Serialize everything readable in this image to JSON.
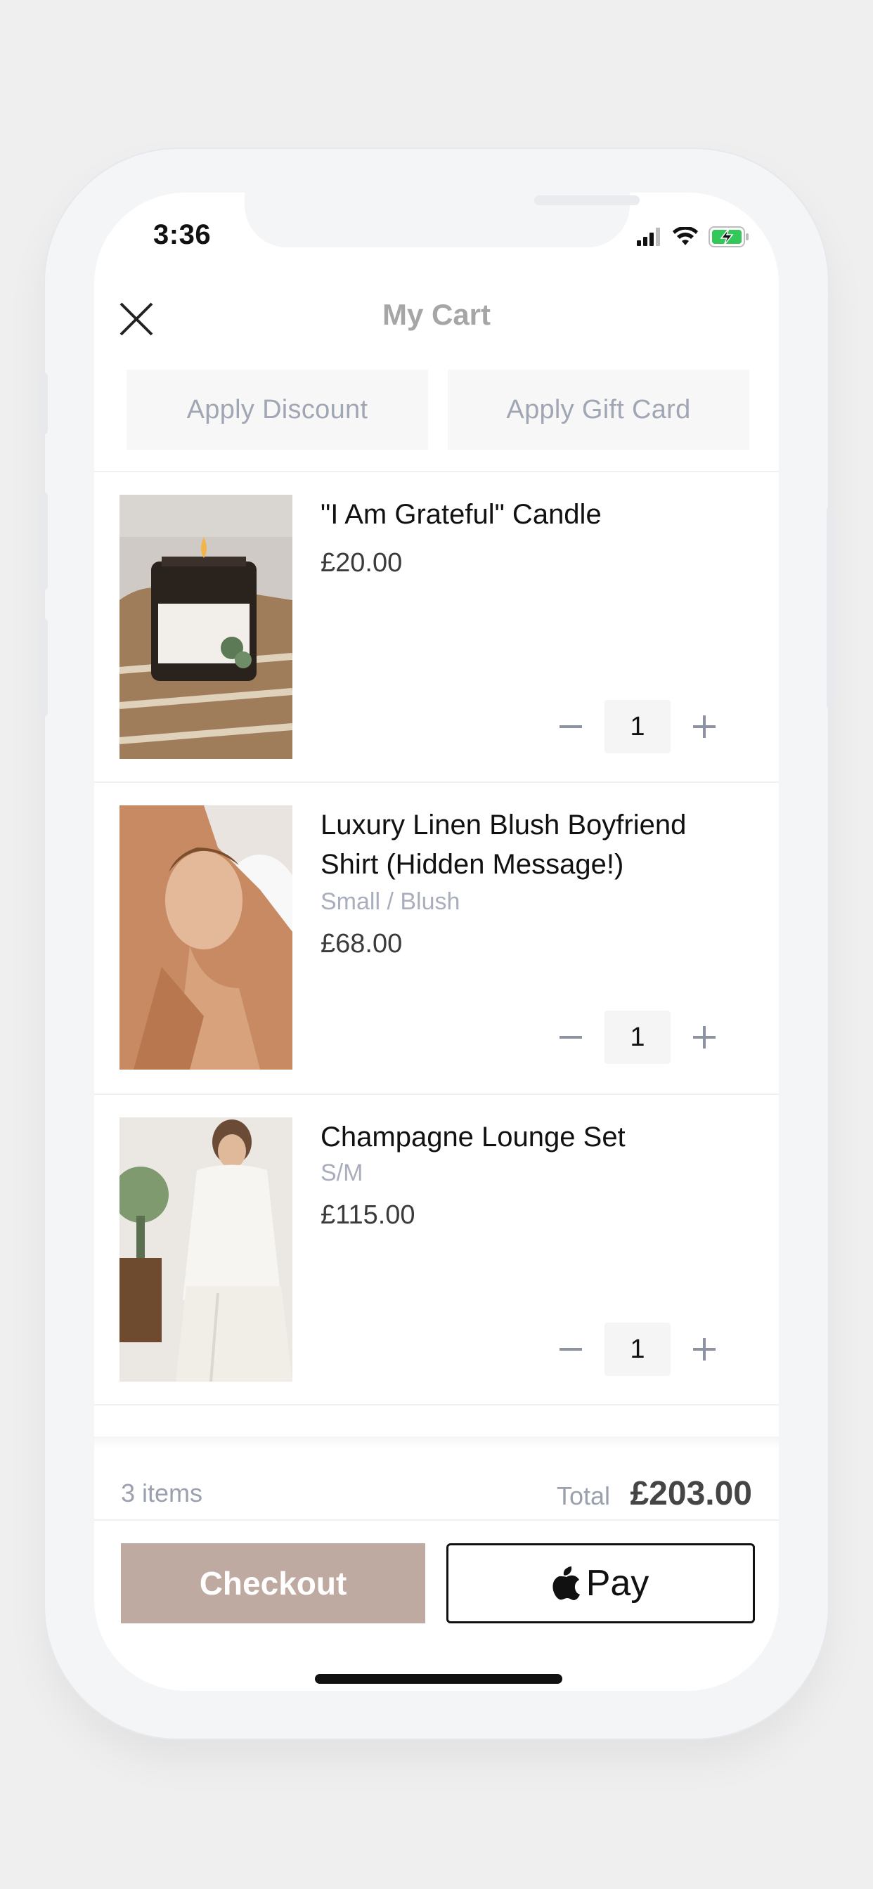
{
  "status_bar": {
    "time": "3:36",
    "icons": [
      "cellular-icon",
      "wifi-icon",
      "battery-charging-icon"
    ]
  },
  "header": {
    "title": "My Cart",
    "close_icon": "close-icon"
  },
  "tabs": [
    {
      "label": "Apply Discount"
    },
    {
      "label": "Apply Gift Card"
    }
  ],
  "items": [
    {
      "name": "\"I Am Grateful\" Candle",
      "variant": "",
      "price": "£20.00",
      "quantity": "1"
    },
    {
      "name": "Luxury Linen Blush Boyfriend Shirt (Hidden Message!)",
      "variant": "Small / Blush",
      "price": "£68.00",
      "quantity": "1"
    },
    {
      "name": "Champagne Lounge Set",
      "variant": "S/M",
      "price": "£115.00",
      "quantity": "1"
    }
  ],
  "summary": {
    "count": "3 items",
    "total_label": "Total",
    "total_value": "£203.00"
  },
  "actions": {
    "checkout": "Checkout",
    "applepay_label": "Pay"
  },
  "colors": {
    "checkout_bg": "#bfaaa1",
    "tab_text": "#a0a6b4",
    "battery_green": "#34c759"
  }
}
